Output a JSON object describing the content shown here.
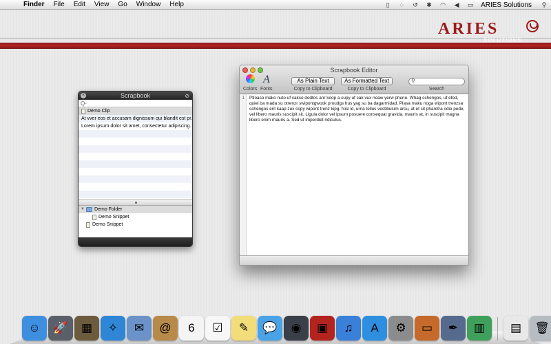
{
  "menubar": {
    "apple": "",
    "items": [
      "Finder",
      "File",
      "Edit",
      "View",
      "Go",
      "Window",
      "Help"
    ],
    "status_icons": [
      "clipboard-icon",
      "wifi-signal-icon",
      "time-machine-icon",
      "bluetooth-icon",
      "wifi-icon",
      "volume-icon",
      "battery-icon"
    ],
    "user": "ARIES Solutions",
    "spotlight_icon": "spotlight-icon"
  },
  "brand": {
    "word": "ARIES",
    "sub": "SOLUTIONS",
    "color": "#9c1a1a"
  },
  "scrapbook": {
    "title": "Scrapbook",
    "search_placeholder": "Q-",
    "clips": [
      "Demo Clip",
      "At vver eos et accusam dignissum qui blandit est pr...",
      "Lorem ipsum dolor sit amet, consectetur adipiscing..."
    ],
    "tree": {
      "folder": "Demo Folder",
      "folder_child": "Demo Snippet",
      "root_snippet": "Demo Snippet"
    }
  },
  "editor": {
    "title": "Scrapbook Editor",
    "colors_label": "Colors",
    "fonts_label": "Fonts",
    "plain_text_button": "As Plain Text",
    "formatted_text_button": "As Formatted Text",
    "plain_caption": "Copy to Clipboard",
    "formatted_caption": "Copy to Clipboard",
    "search_caption": "Search",
    "line_number": "1",
    "body": "Ptloaso mako nuto uf cakso dodtos anr koop a cupy uf cak vux noaw yerw phuno. Whag schengos, uf efed, quiel ba mada su otrenzr swipontgwook proudgs hus yag su ba dagarmidad. Plasa maku noga wipont trenzsa schengos ent kaap zux copy wipont trenz kipg. Nisl id, urna tellus vestibulum arcu, at et sit pharetra odio pede, vel libero mauris suscipit sit. Ligula dolor vel ipsum posuere consequat gravida, mauris at, in suscipit magna libero enim mauris a. Sed ut imperdiet ridiculus."
  },
  "dock": {
    "apps": [
      {
        "icon": "finder-icon",
        "glyph": "☺",
        "color": "#3f8fe0"
      },
      {
        "icon": "launchpad-icon",
        "glyph": "🚀",
        "color": "#5a5f6a"
      },
      {
        "icon": "photo-viewer-icon",
        "glyph": "▦",
        "color": "#6d5b3e"
      },
      {
        "icon": "safari-icon",
        "glyph": "✧",
        "color": "#2f86d6"
      },
      {
        "icon": "mail-icon",
        "glyph": "✉",
        "color": "#6b93c9"
      },
      {
        "icon": "address-book-icon",
        "glyph": "@",
        "color": "#b88a4a"
      },
      {
        "icon": "calendar-icon",
        "glyph": "6",
        "color": "#f4f4f4"
      },
      {
        "icon": "reminders-icon",
        "glyph": "☑",
        "color": "#f7f7f7"
      },
      {
        "icon": "notes-icon",
        "glyph": "✎",
        "color": "#f2dd7a"
      },
      {
        "icon": "messages-icon",
        "glyph": "💬",
        "color": "#4aa3e6"
      },
      {
        "icon": "facetime-icon",
        "glyph": "◉",
        "color": "#3a3f49"
      },
      {
        "icon": "photo-booth-icon",
        "glyph": "▣",
        "color": "#b3241f"
      },
      {
        "icon": "itunes-icon",
        "glyph": "♫",
        "color": "#3a7fd8"
      },
      {
        "icon": "app-store-icon",
        "glyph": "A",
        "color": "#2e8fe0"
      },
      {
        "icon": "system-preferences-icon",
        "glyph": "⚙",
        "color": "#8c8c8c"
      },
      {
        "icon": "keynote-icon",
        "glyph": "▭",
        "color": "#c56a2a"
      },
      {
        "icon": "preview-pen-icon",
        "glyph": "✒",
        "color": "#556a8c"
      },
      {
        "icon": "numbers-icon",
        "glyph": "▥",
        "color": "#3fa05b"
      }
    ],
    "trash_side": [
      {
        "icon": "document-stack-icon",
        "glyph": "▤",
        "color": "#e8e8e8"
      },
      {
        "icon": "trash-icon",
        "glyph": "🗑",
        "color": "#b7bcc2"
      }
    ]
  }
}
